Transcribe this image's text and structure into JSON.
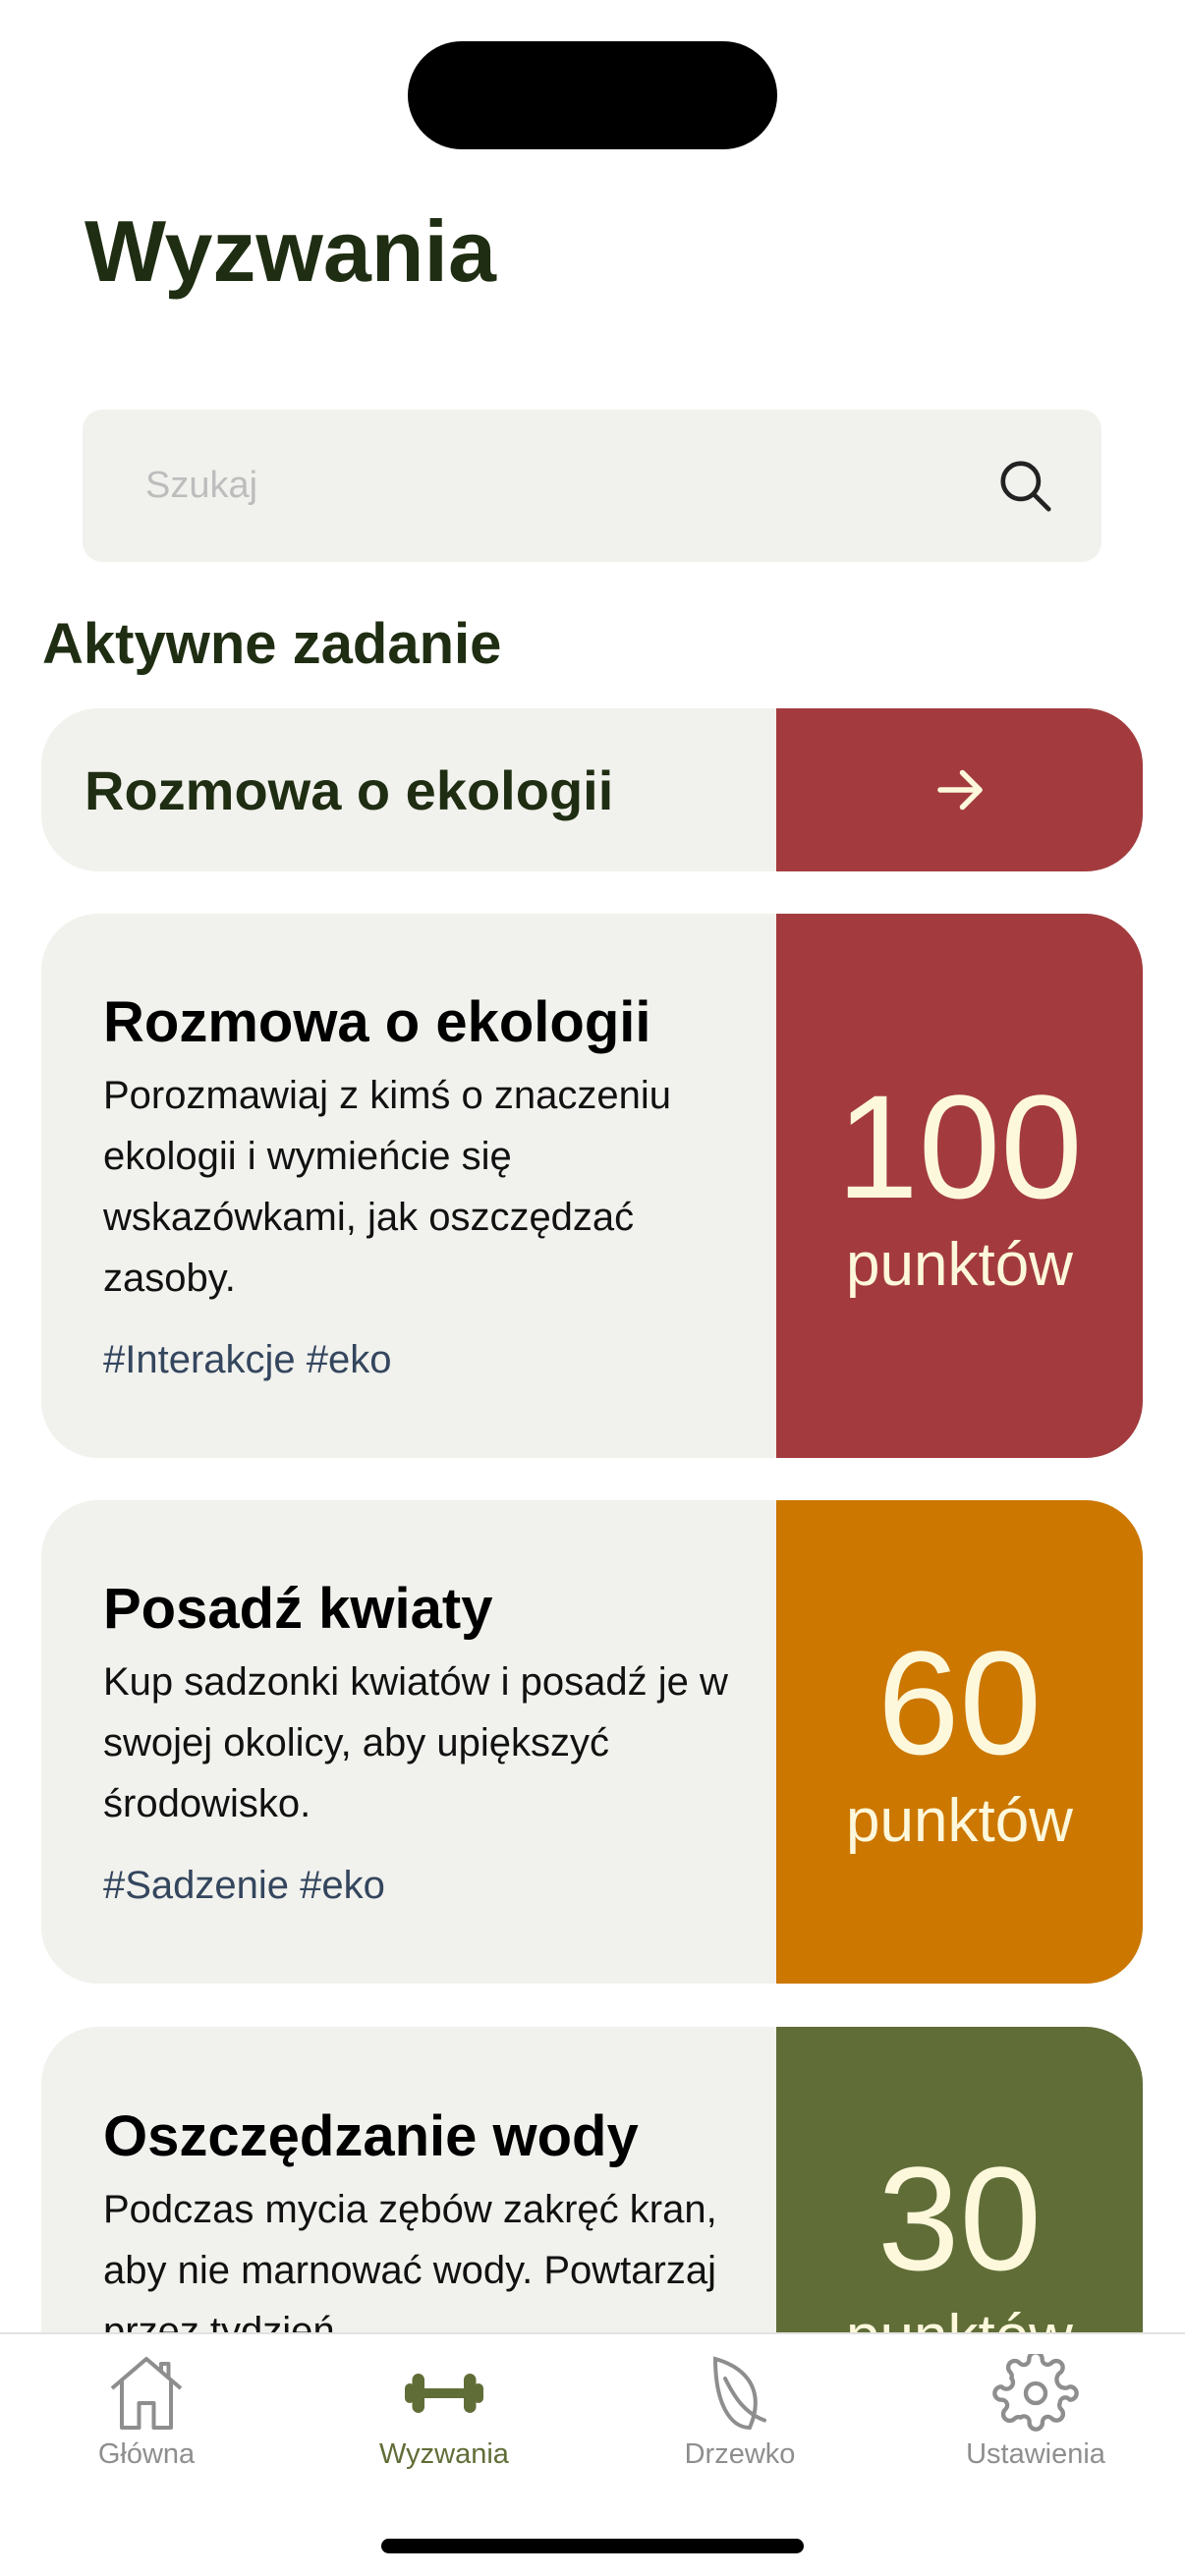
{
  "header": {
    "title": "Wyzwania"
  },
  "search": {
    "placeholder": "Szukaj",
    "icon": "search-icon"
  },
  "active_section": {
    "label": "Aktywne zadanie",
    "task": "Rozmowa o ekologii",
    "icon": "arrow-right-icon"
  },
  "challenges": [
    {
      "title": "Rozmowa o ekologii",
      "description": "Porozmawiaj z kimś o znaczeniu ekologii i wymieńcie się wskazówkami, jak oszczędzać zasoby.",
      "tags": "#Interakcje #eko",
      "points": "100",
      "points_label": "punktów",
      "color": "#a33b3e"
    },
    {
      "title": "Posadź kwiaty",
      "description": "Kup sadzonki kwiatów i posadź je w swojej okolicy, aby upiększyć środowisko.",
      "tags": "#Sadzenie #eko",
      "points": "60",
      "points_label": "punktów",
      "color": "#cc7700"
    },
    {
      "title": "Oszczędzanie wody",
      "description": "Podczas mycia zębów zakręć kran, aby nie marnować wody. Powtarzaj przez tydzień.",
      "points": "30",
      "points_label": "punktów",
      "color": "#606d37"
    }
  ],
  "tabbar": {
    "items": [
      {
        "label": "Główna",
        "icon": "home-icon"
      },
      {
        "label": "Wyzwania",
        "icon": "dumbbell-icon",
        "active": true
      },
      {
        "label": "Drzewko",
        "icon": "leaf-icon"
      },
      {
        "label": "Ustawienia",
        "icon": "gear-icon"
      }
    ],
    "active_color": "#606d37"
  },
  "colors": {
    "title": "#1f2d12",
    "card_bg": "#f1f1ed",
    "points_text": "#fdf8dc"
  }
}
